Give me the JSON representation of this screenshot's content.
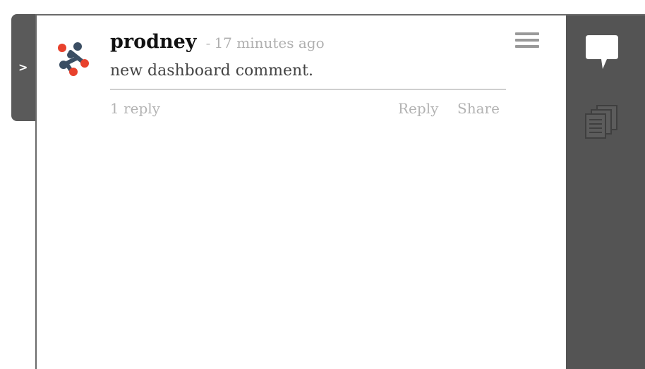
{
  "collapse_tab": {
    "label": ">"
  },
  "comment": {
    "author": "prodney",
    "separator": "-",
    "timestamp": "17 minutes ago",
    "body": "new dashboard comment.",
    "replies_label": "1 reply",
    "reply_label": "Reply",
    "share_label": "Share",
    "avatar_icon": "molecule-avatar-icon"
  },
  "sidebar": {
    "items": [
      {
        "icon": "chat-bubble-icon"
      },
      {
        "icon": "documents-icon"
      }
    ]
  },
  "colors": {
    "sidebar_bg": "#545454",
    "avatar_red": "#e8412c",
    "avatar_navy": "#3b4e63",
    "muted_text": "#b3b3b3"
  }
}
